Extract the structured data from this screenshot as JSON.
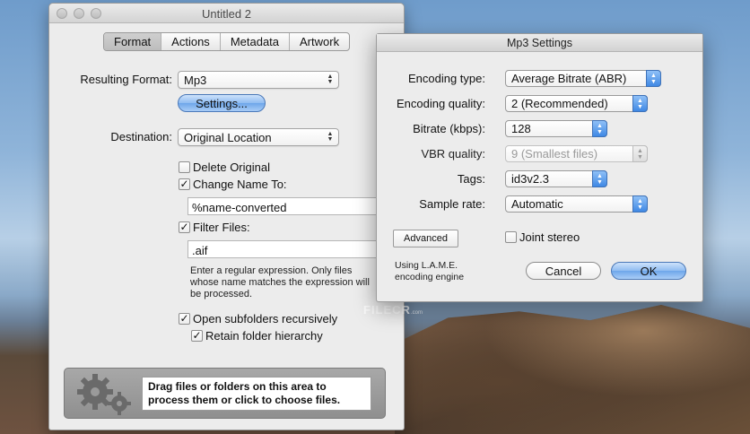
{
  "main_window": {
    "title": "Untitled 2",
    "tabs": [
      {
        "label": "Format",
        "selected": true
      },
      {
        "label": "Actions",
        "selected": false
      },
      {
        "label": "Metadata",
        "selected": false
      },
      {
        "label": "Artwork",
        "selected": false
      }
    ],
    "resulting_format_label": "Resulting Format:",
    "resulting_format_value": "Mp3",
    "settings_button": "Settings...",
    "destination_label": "Destination:",
    "destination_value": "Original Location",
    "delete_original_label": "Delete Original",
    "delete_original_checked": false,
    "change_name_label": "Change Name To:",
    "change_name_checked": true,
    "change_name_value": "%name-converted",
    "filter_files_label": "Filter Files:",
    "filter_files_checked": true,
    "filter_files_value": ".aif",
    "filter_help": "Enter a regular expression. Only files whose name matches the expression will be processed.",
    "open_subfolders_label": "Open subfolders recursively",
    "open_subfolders_checked": true,
    "retain_hierarchy_label": "Retain folder hierarchy",
    "retain_hierarchy_checked": true,
    "dropzone_text": "Drag files or folders on this area to process them or click to choose files."
  },
  "mp3_settings": {
    "title": "Mp3 Settings",
    "encoding_type_label": "Encoding type:",
    "encoding_type_value": "Average Bitrate (ABR)",
    "encoding_quality_label": "Encoding quality:",
    "encoding_quality_value": "2 (Recommended)",
    "bitrate_label": "Bitrate (kbps):",
    "bitrate_value": "128",
    "vbr_quality_label": "VBR quality:",
    "vbr_quality_value": "9 (Smallest files)",
    "tags_label": "Tags:",
    "tags_value": "id3v2.3",
    "sample_rate_label": "Sample rate:",
    "sample_rate_value": "Automatic",
    "advanced_button": "Advanced",
    "joint_stereo_label": "Joint stereo",
    "joint_stereo_checked": false,
    "engine_note": "Using L.A.M.E. encoding engine",
    "cancel_button": "Cancel",
    "ok_button": "OK"
  },
  "watermark": {
    "text": "FILECR",
    "sub": ".com"
  },
  "colors": {
    "accent_blue": "#3f88e4",
    "window_bg": "#ececec"
  }
}
